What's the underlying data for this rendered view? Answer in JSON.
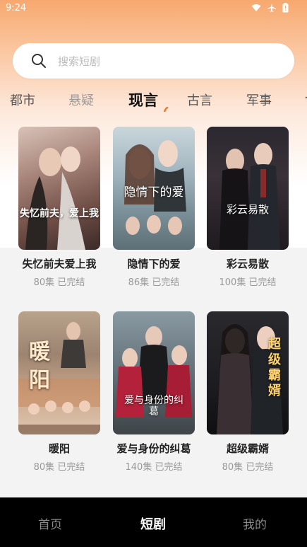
{
  "status_bar": {
    "time": "9:24",
    "icons": [
      "wifi-icon",
      "airplane-icon",
      "battery-icon"
    ]
  },
  "search": {
    "placeholder": "搜索短剧",
    "value": ""
  },
  "tabs": [
    {
      "label": "都市",
      "active": false
    },
    {
      "label": "悬疑",
      "active": false
    },
    {
      "label": "现言",
      "active": true
    },
    {
      "label": "古言",
      "active": false
    },
    {
      "label": "军事",
      "active": false
    }
  ],
  "dramas": [
    {
      "title": "失忆前夫爱上我",
      "episodes": "80集",
      "status": "已完结",
      "poster_text": "失忆前夫，爱上我"
    },
    {
      "title": "隐情下的爱",
      "episodes": "86集",
      "status": "已完结",
      "poster_text": "隐情下的爱"
    },
    {
      "title": "彩云易散",
      "episodes": "100集",
      "status": "已完结",
      "poster_text": "彩云易散"
    },
    {
      "title": "暖阳",
      "episodes": "80集",
      "status": "已完结",
      "poster_text": "暖阳"
    },
    {
      "title": "爱与身份的纠葛",
      "episodes": "140集",
      "status": "已完结",
      "poster_text": "爱与身份的纠葛"
    },
    {
      "title": "超级霸婿",
      "episodes": "80集",
      "status": "已完结",
      "poster_text": "超级霸婿"
    }
  ],
  "bottom_nav": [
    {
      "label": "首页",
      "active": false
    },
    {
      "label": "短剧",
      "active": true
    },
    {
      "label": "我的",
      "active": false
    }
  ],
  "colors": {
    "accent": "#f07a2c",
    "nav_bg": "#000000",
    "header_gradient": "#f7a86e"
  }
}
